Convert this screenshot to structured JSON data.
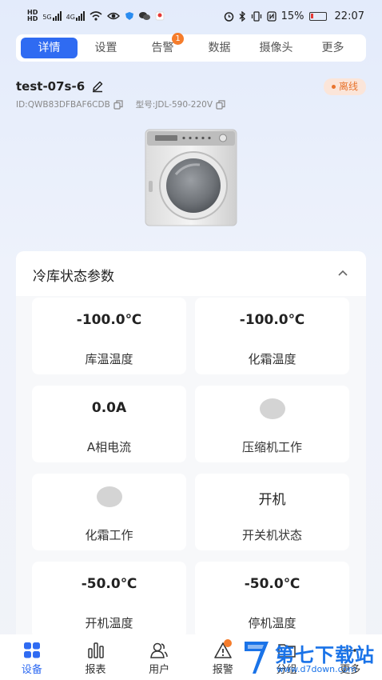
{
  "status_bar": {
    "time": "22:07",
    "battery": "15%",
    "signal_1": "5G",
    "signal_2": "4G"
  },
  "tabs": [
    {
      "label": "详情",
      "active": true
    },
    {
      "label": "设置"
    },
    {
      "label": "告警",
      "badge": "1"
    },
    {
      "label": "数据"
    },
    {
      "label": "摄像头"
    },
    {
      "label": "更多"
    }
  ],
  "device": {
    "name": "test-07s-6",
    "status": "离线",
    "id": "ID:QWB83DFBAF6CDB",
    "model": "型号:JDL-590-220V"
  },
  "card": {
    "title": "冷库状态参数",
    "items": [
      {
        "value": "-100.0℃",
        "label": "库温温度"
      },
      {
        "value": "-100.0℃",
        "label": "化霜温度"
      },
      {
        "value": "0.0A",
        "label": "A相电流"
      },
      {
        "value": "",
        "label": "压缩机工作",
        "indicator": "off"
      },
      {
        "value": "",
        "label": "化霜工作",
        "indicator": "off"
      },
      {
        "value": "开机",
        "label": "开关机状态"
      },
      {
        "value": "-50.0℃",
        "label": "开机温度"
      },
      {
        "value": "-50.0℃",
        "label": "停机温度"
      }
    ]
  },
  "bottom_nav": [
    {
      "label": "设备",
      "icon": "grid-icon",
      "active": true
    },
    {
      "label": "报表",
      "icon": "bar-chart-icon"
    },
    {
      "label": "用户",
      "icon": "users-icon"
    },
    {
      "label": "报警",
      "icon": "warning-icon"
    },
    {
      "label": "分组",
      "icon": "folder-icon"
    },
    {
      "label": "更多",
      "icon": "more-icon"
    }
  ],
  "watermark": {
    "title": "第七下载站",
    "url": "www.d7down.com"
  },
  "colors": {
    "accent": "#2f6bf2",
    "offline": "#e8742e",
    "badge": "#f57c2b"
  }
}
